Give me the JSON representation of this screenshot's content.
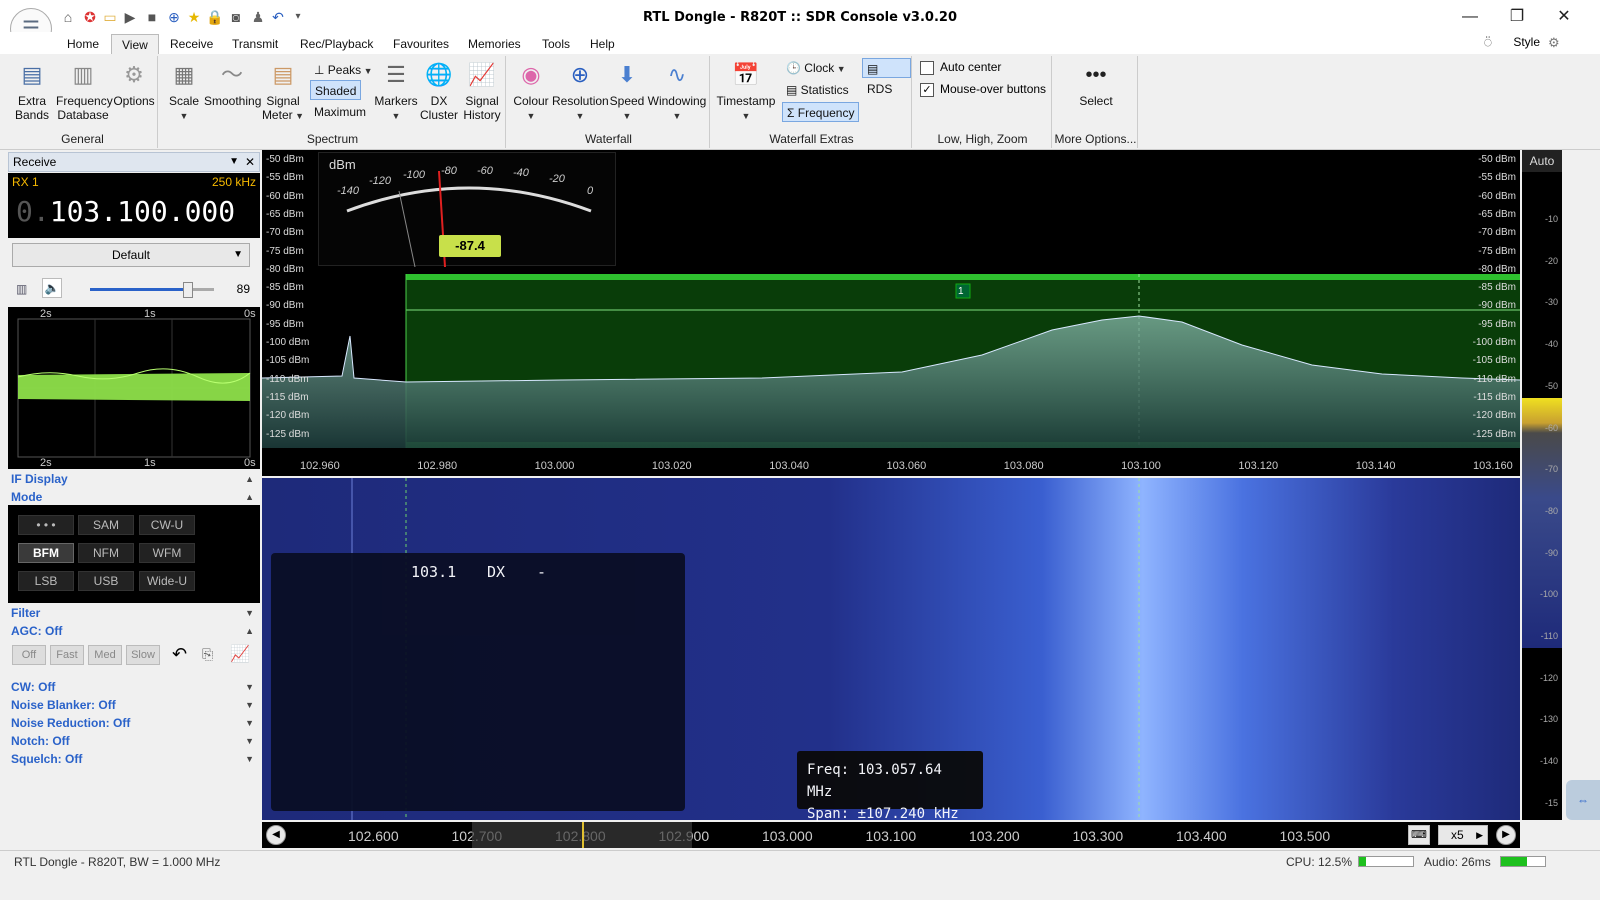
{
  "window": {
    "title": "RTL Dongle - R820T :: SDR Console v3.0.20"
  },
  "menu": {
    "tabs": [
      "Home",
      "View",
      "Receive",
      "Transmit",
      "Rec/Playback",
      "Favourites",
      "Memories",
      "Tools",
      "Help"
    ],
    "active": "View",
    "style_label": "Style"
  },
  "ribbon": {
    "general": {
      "label": "General",
      "extra_bands": "Extra Bands",
      "freq_db": "Frequency Database",
      "options": "Options"
    },
    "spectrum": {
      "label": "Spectrum",
      "scale": "Scale",
      "smoothing": "Smoothing",
      "signal_meter": "Signal Meter",
      "peaks": "Peaks",
      "shaded": "Shaded",
      "maximum": "Maximum",
      "markers": "Markers",
      "dx_cluster": "DX Cluster",
      "signal_history": "Signal History"
    },
    "waterfall": {
      "label": "Waterfall",
      "colour": "Colour",
      "resolution": "Resolution",
      "speed": "Speed",
      "windowing": "Windowing"
    },
    "waterfall_extras": {
      "label": "Waterfall Extras",
      "timestamp": "Timestamp",
      "clock": "Clock",
      "statistics": "Statistics",
      "frequency": "Frequency",
      "rds": "RDS"
    },
    "zoom": {
      "label": "Low, High, Zoom",
      "auto_center": "Auto center",
      "auto_center_checked": false,
      "mouse_over": "Mouse-over buttons",
      "mouse_over_checked": true
    },
    "more": {
      "label": "More Options...",
      "select": "Select"
    }
  },
  "receive": {
    "header": "Receive",
    "rx_label": "RX 1",
    "bandwidth": "250 kHz",
    "freq_prefix": "0.",
    "frequency": "103.100.000",
    "preset": "Default",
    "volume": "89",
    "volume_level": 0.82,
    "scope_labels": [
      "2s",
      "1s",
      "0s"
    ]
  },
  "sections": {
    "if_display": "IF Display",
    "mode": "Mode",
    "filter": "Filter",
    "agc": "AGC: Off",
    "cw": "CW: Off",
    "noise_blanker": "Noise Blanker: Off",
    "noise_reduction": "Noise Reduction: Off",
    "notch": "Notch: Off",
    "squelch": "Squelch: Off"
  },
  "modes": [
    [
      "• • •",
      "SAM",
      "CW-U"
    ],
    [
      "BFM",
      "NFM",
      "WFM"
    ],
    [
      "LSB",
      "USB",
      "Wide-U"
    ]
  ],
  "selected_mode": "BFM",
  "agc_buttons": [
    "Off",
    "Fast",
    "Med",
    "Slow"
  ],
  "spectrum": {
    "dbm_labels": [
      "-50 dBm",
      "-55 dBm",
      "-60 dBm",
      "-65 dBm",
      "-70 dBm",
      "-75 dBm",
      "-80 dBm",
      "-85 dBm",
      "-90 dBm",
      "-95 dBm",
      "-100 dBm",
      "-105 dBm",
      "-110 dBm",
      "-115 dBm",
      "-120 dBm",
      "-125 dBm"
    ],
    "freq_labels": [
      "102.960",
      "102.980",
      "103.000",
      "103.020",
      "103.040",
      "103.060",
      "103.080",
      "103.100",
      "103.120",
      "103.140",
      "103.160"
    ],
    "marker": "1",
    "meter_unit": "dBm",
    "meter_scale": [
      "-140",
      "-120",
      "-100",
      "-80",
      "-60",
      "-40",
      "-20",
      "0"
    ],
    "meter_value": "-87.4"
  },
  "waterfall": {
    "rds_freq": "103.1",
    "rds_dx": "DX",
    "rds_dash": "-",
    "tip_freq_label": "Freq:",
    "tip_freq": "103.057.64 MHz",
    "tip_span_label": "Span:",
    "tip_span": "±107.240 kHz",
    "bottom_freqs": [
      "102.600",
      "102.700",
      "102.800",
      "102.900",
      "103.000",
      "103.100",
      "103.200",
      "103.300",
      "103.400",
      "103.500"
    ],
    "zoom": "x5",
    "auto": "Auto",
    "right_scale": [
      "-10",
      "-20",
      "-30",
      "-40",
      "-50",
      "-60",
      "-70",
      "-80",
      "-90",
      "-100",
      "-110",
      "-120",
      "-130",
      "-140",
      "-15"
    ]
  },
  "status": {
    "left": "RTL Dongle - R820T, BW = 1.000 MHz",
    "cpu": "CPU: 12.5%",
    "cpu_level": 0.125,
    "audio": "Audio: 26ms",
    "audio_level": 0.6
  }
}
